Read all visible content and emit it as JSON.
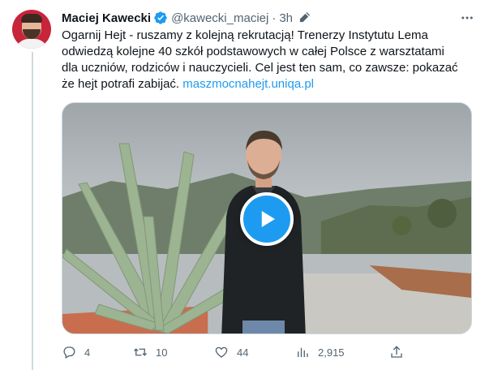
{
  "tweet": {
    "author_name": "Maciej Kawecki",
    "handle": "@kawecki_maciej",
    "separator": "·",
    "time": "3h",
    "text_lines": [
      "Ogarnij Hejt - ruszamy z kolejną rekrutacją! Trenerzy Instytutu Lema",
      "odwiedzą kolejne 40 szkół podstawowych w całej Polsce z warsztatami",
      "dla uczniów, rodziców i nauczycieli. Cel jest ten sam, co zawsze: pokazać"
    ],
    "text_last_line": "że hejt potrafi zabijać.",
    "link": "maszmocnahejt.uniqa.pl"
  },
  "actions": {
    "replies": "4",
    "retweets": "10",
    "likes": "44",
    "views": "2,915"
  },
  "icons": {
    "verified": "verified-badge-icon",
    "edit": "edited-pencil-icon",
    "more": "more-dots-icon",
    "play": "play-icon",
    "reply": "reply-icon",
    "retweet": "retweet-icon",
    "like": "heart-icon",
    "views": "views-chart-icon",
    "share": "share-icon"
  },
  "colors": {
    "accent": "#1d9bf0",
    "text": "#0f1419",
    "secondary": "#536471",
    "avatar_bg": "#c8243a"
  }
}
